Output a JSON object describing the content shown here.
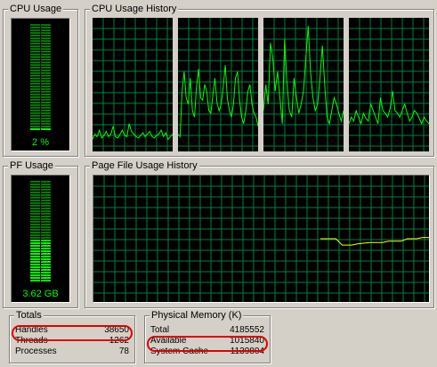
{
  "cpu_usage": {
    "title": "CPU Usage",
    "value": "2 %",
    "fraction": 0.02
  },
  "cpu_history": {
    "title": "CPU Usage History",
    "series": [
      [
        8,
        12,
        10,
        15,
        9,
        11,
        14,
        10,
        12,
        18,
        10,
        9,
        12,
        15,
        11,
        10,
        20,
        14,
        12,
        10,
        9,
        11,
        13,
        10,
        12,
        14,
        10,
        9,
        11,
        12,
        15,
        10,
        13,
        8,
        10,
        12
      ],
      [
        12,
        10,
        45,
        60,
        40,
        35,
        55,
        30,
        25,
        48,
        62,
        40,
        38,
        50,
        45,
        30,
        28,
        42,
        55,
        36,
        30,
        35,
        48,
        65,
        40,
        30,
        25,
        35,
        55,
        60,
        38,
        25,
        20,
        30,
        45,
        50,
        35,
        28,
        25,
        18
      ],
      [
        30,
        50,
        35,
        82,
        70,
        45,
        60,
        40,
        20,
        85,
        50,
        30,
        25,
        55,
        40,
        28,
        35,
        45,
        70,
        95,
        60,
        40,
        30,
        35,
        55,
        80,
        50,
        25,
        20,
        30,
        40,
        35,
        28,
        22,
        30
      ],
      [
        20,
        25,
        22,
        30,
        25,
        20,
        28,
        24,
        22,
        35,
        30,
        25,
        20,
        40,
        30,
        28,
        25,
        32,
        45,
        30,
        28,
        25,
        30,
        35,
        28,
        22,
        25,
        30,
        28,
        24,
        20,
        25,
        22,
        20
      ]
    ]
  },
  "pf_usage": {
    "title": "PF Usage",
    "value": "3.62 GB",
    "fraction": 0.43
  },
  "pf_history": {
    "title": "Page File Usage History",
    "points": [
      [
        0,
        50
      ],
      [
        5,
        50
      ],
      [
        7,
        45
      ],
      [
        10,
        45
      ],
      [
        12,
        46
      ],
      [
        16,
        47
      ],
      [
        20,
        47
      ],
      [
        22,
        48
      ],
      [
        26,
        48
      ],
      [
        28,
        50
      ],
      [
        31,
        50
      ],
      [
        33,
        51
      ],
      [
        35,
        51
      ]
    ]
  },
  "totals": {
    "title": "Totals",
    "rows": [
      {
        "label": "Handles",
        "value": "38650"
      },
      {
        "label": "Threads",
        "value": "1262"
      },
      {
        "label": "Processes",
        "value": "78"
      }
    ]
  },
  "physical_memory": {
    "title": "Physical Memory (K)",
    "rows": [
      {
        "label": "Total",
        "value": "4185552"
      },
      {
        "label": "Available",
        "value": "1015840"
      },
      {
        "label": "System Cache",
        "value": "1139804"
      }
    ]
  },
  "colors": {
    "grid": "#008040",
    "trace": "#00ff00",
    "pf_trace": "#ffff00",
    "meter_off": "#007a00",
    "meter_on": "#00ff00",
    "highlight": "#e00000"
  }
}
